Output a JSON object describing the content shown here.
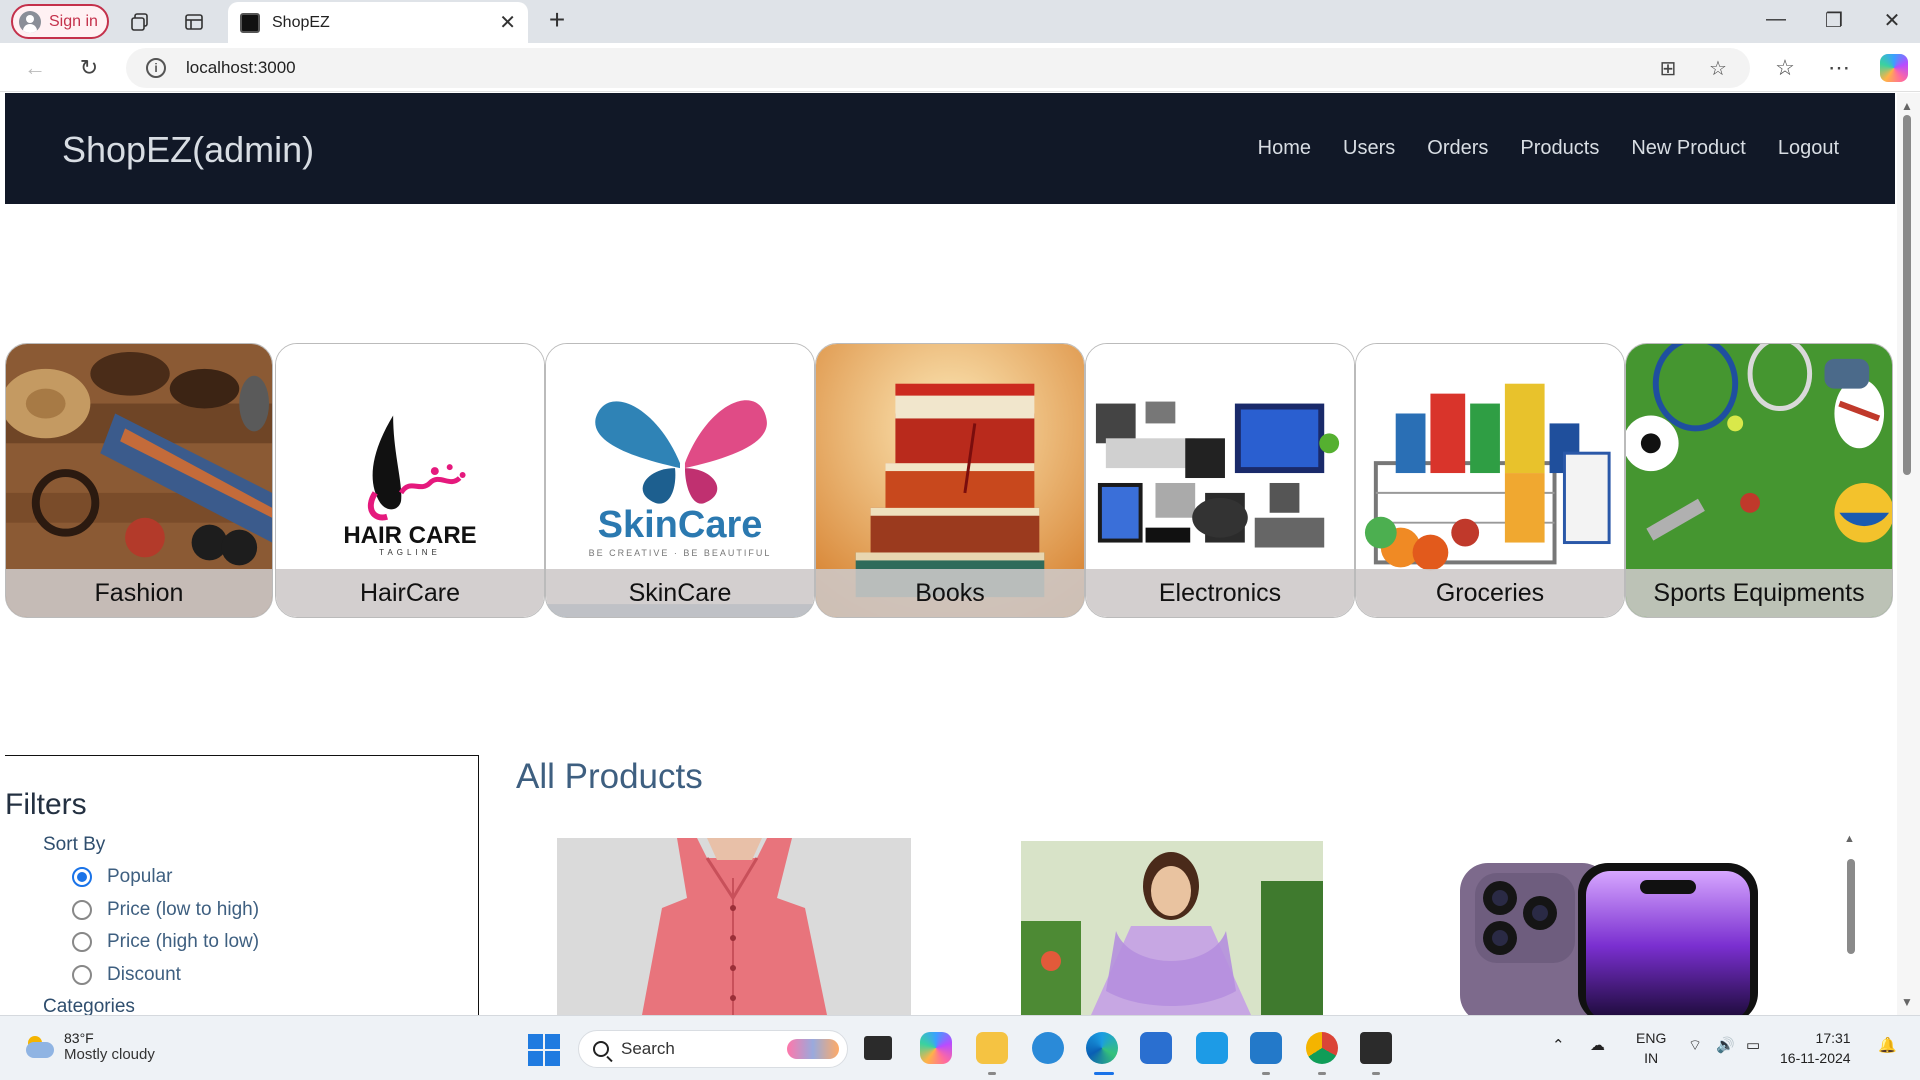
{
  "browser": {
    "sign_in": "Sign in",
    "tab_title": "ShopEZ",
    "url": "localhost:3000"
  },
  "navbar": {
    "brand": "ShopEZ(admin)",
    "links": [
      "Home",
      "Users",
      "Orders",
      "Products",
      "New Product",
      "Logout"
    ]
  },
  "categories": [
    {
      "label": "Fashion",
      "icon": "fashion-image"
    },
    {
      "label": "HairCare",
      "icon": "haircare-image"
    },
    {
      "label": "SkinCare",
      "icon": "skincare-image"
    },
    {
      "label": "Books",
      "icon": "books-image"
    },
    {
      "label": "Electronics",
      "icon": "electronics-image"
    },
    {
      "label": "Groceries",
      "icon": "groceries-image"
    },
    {
      "label": "Sports Equipments",
      "icon": "sports-image"
    }
  ],
  "category_art": {
    "haircare_logo": "HAIR CARE",
    "haircare_tagline": "TAGLINE",
    "skincare_logo": "SkinCare",
    "skincare_tagline": "BE CREATIVE · BE BEAUTIFUL"
  },
  "filters": {
    "title": "Filters",
    "sort_by": "Sort By",
    "options": [
      {
        "label": "Popular",
        "checked": true
      },
      {
        "label": "Price (low to high)",
        "checked": false
      },
      {
        "label": "Price (high to low)",
        "checked": false
      },
      {
        "label": "Discount",
        "checked": false
      }
    ],
    "categories_heading": "Categories"
  },
  "products": {
    "title": "All Products",
    "items": [
      {
        "icon": "pink-shirt-image"
      },
      {
        "icon": "lavender-kurta-image"
      },
      {
        "icon": "purple-phone-image"
      }
    ]
  },
  "taskbar": {
    "temperature": "83°F",
    "weather": "Mostly cloudy",
    "search": "Search",
    "lang_1": "ENG",
    "lang_2": "IN",
    "time": "17:31",
    "date": "16-11-2024"
  },
  "colors": {
    "navbar_bg": "#111827",
    "heading": "#3e5f80",
    "radio_active": "#1a73e8",
    "signin_border": "#c4314b"
  }
}
